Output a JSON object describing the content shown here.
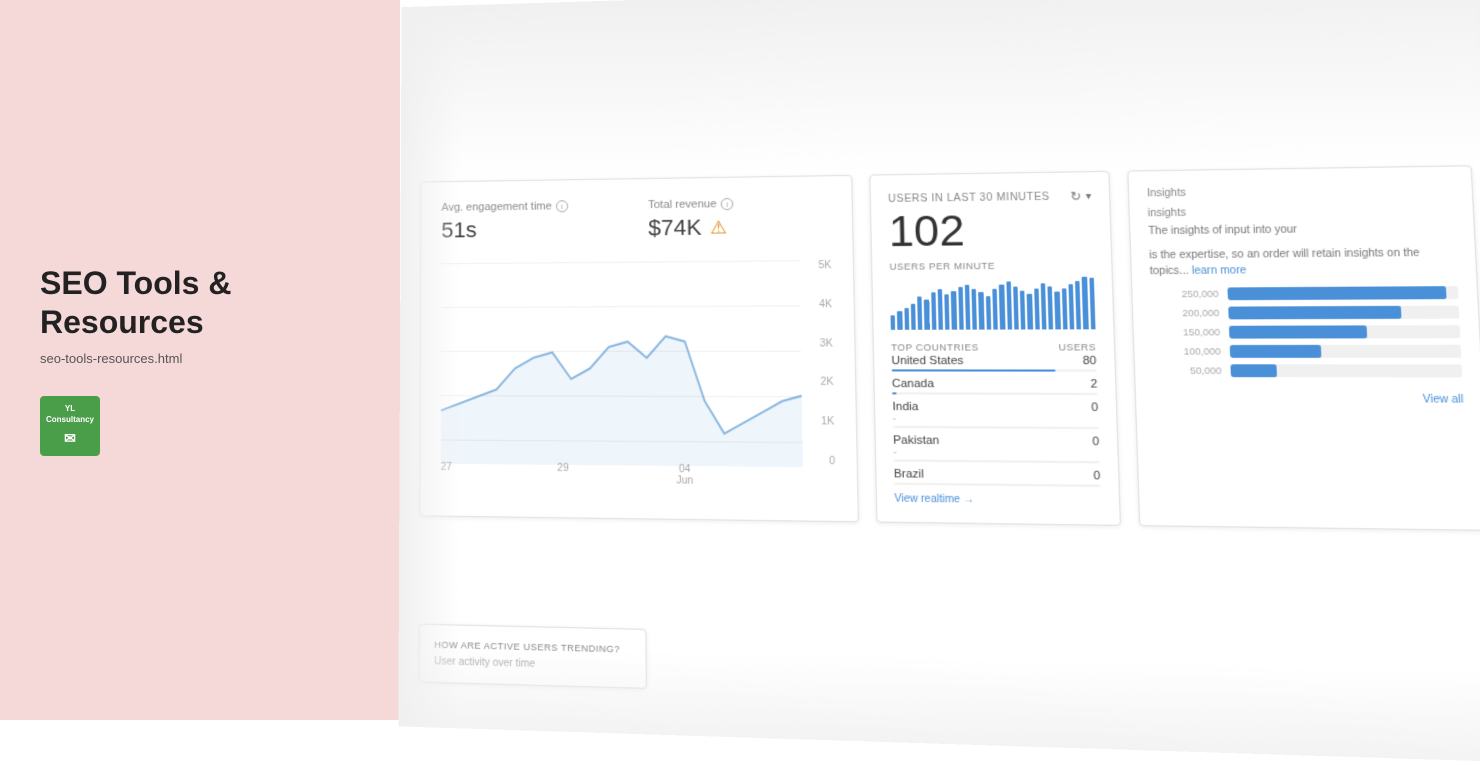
{
  "left": {
    "title": "SEO Tools & Resources",
    "url": "seo-tools-resources.html",
    "logo_line1": "YL Consultancy",
    "logo_icon": "✉"
  },
  "analytics": {
    "metric1": {
      "label": "Avg. engagement time",
      "value": "51s"
    },
    "metric2": {
      "label": "Total revenue",
      "value": "$74K",
      "has_warning": true
    },
    "chart": {
      "y_labels": [
        "5K",
        "4K",
        "3K",
        "2K",
        "1K",
        "0"
      ],
      "x_labels": [
        {
          "date": "27",
          "month": ""
        },
        {
          "date": "29",
          "month": ""
        },
        {
          "date": "04",
          "month": "Jun"
        },
        {
          "date": "",
          "month": ""
        }
      ]
    },
    "users_panel": {
      "header": "USERS IN LAST 30 MINUTES",
      "count": "102",
      "per_minute_label": "USERS PER MINUTE",
      "bars": [
        20,
        25,
        30,
        35,
        45,
        40,
        50,
        55,
        48,
        52,
        58,
        60,
        55,
        50,
        45,
        55,
        60,
        65,
        58,
        52,
        48,
        55,
        62,
        58,
        50,
        55,
        60,
        65,
        70,
        68
      ],
      "top_countries_label": "TOP COUNTRIES",
      "users_col_label": "USERS",
      "countries": [
        {
          "name": "United States",
          "users": "80",
          "bar_pct": 80,
          "sub": ""
        },
        {
          "name": "Canada",
          "users": "2",
          "bar_pct": 2,
          "sub": ""
        },
        {
          "name": "India",
          "users": "0",
          "bar_pct": 0,
          "sub": "-"
        },
        {
          "name": "Pakistan",
          "users": "0",
          "bar_pct": 0,
          "sub": "-"
        },
        {
          "name": "Brazil",
          "users": "0",
          "bar_pct": 0,
          "sub": ""
        }
      ],
      "view_realtime": "View realtime →"
    },
    "insights": {
      "title": "Insights",
      "subtitle": "insights",
      "text1": "The insights of input into your",
      "text2": "is the expertise, so an order will retain insights on the topics...",
      "link": "learn more",
      "horiz_bars": [
        {
          "label": "250,000",
          "pct": 95
        },
        {
          "label": "200,000",
          "pct": 75
        },
        {
          "label": "150,000",
          "pct": 60
        },
        {
          "label": "100,000",
          "pct": 40
        },
        {
          "label": "50,000",
          "pct": 20
        }
      ],
      "view_all": "View all"
    },
    "bottom1": {
      "title": "HOW ARE ACTIVE USERS TRENDING?",
      "sub": "User activity over time"
    }
  }
}
